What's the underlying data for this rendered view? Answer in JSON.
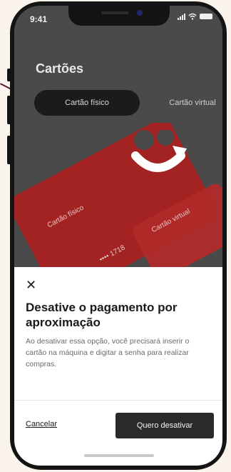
{
  "status": {
    "time": "9:41"
  },
  "page": {
    "title": "Cartões"
  },
  "tabs": [
    {
      "label": "Cartão físico",
      "active": true
    },
    {
      "label": "Cartão virtual",
      "active": false
    }
  ],
  "card": {
    "physical_label": "Cartão físico",
    "number": "•••• 1718",
    "virtual_label": "Cartão virtual"
  },
  "sheet": {
    "title": "Desative o pagamento por aproximação",
    "description": "Ao desativar essa opção, você precisará inserir o cartão na máquina e digitar a senha para realizar compras.",
    "cancel_label": "Cancelar",
    "confirm_label": "Quero desativar"
  },
  "colors": {
    "accent": "#a32323",
    "connector": "#5c1730",
    "background": "#fbf4ec"
  }
}
